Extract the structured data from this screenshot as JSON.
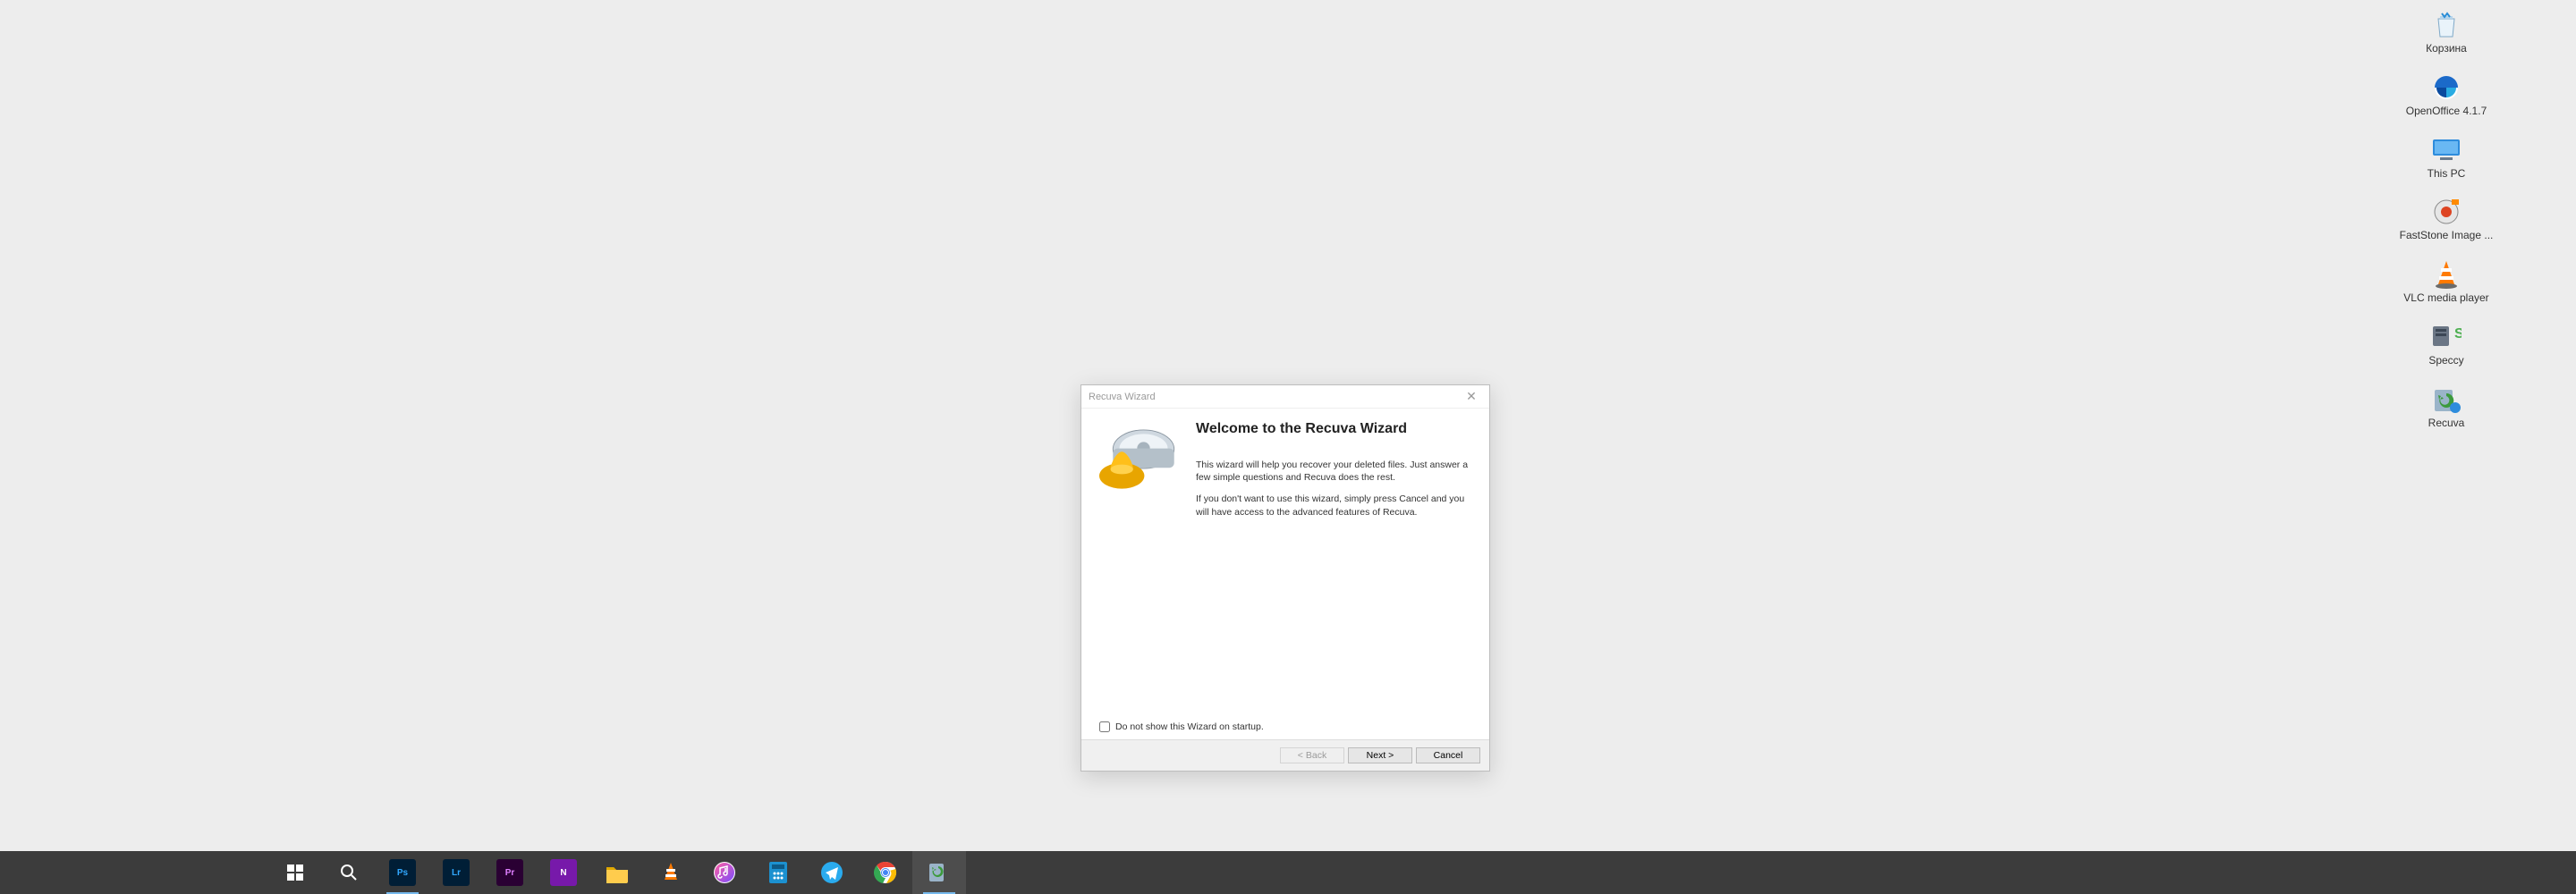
{
  "desktop": {
    "icons": [
      {
        "name": "recycle-bin",
        "label": "Корзина"
      },
      {
        "name": "openoffice",
        "label": "OpenOffice 4.1.7"
      },
      {
        "name": "this-pc",
        "label": "This PC"
      },
      {
        "name": "faststone",
        "label": "FastStone Image ..."
      },
      {
        "name": "vlc",
        "label": "VLC media player"
      },
      {
        "name": "speccy",
        "label": "Speccy"
      },
      {
        "name": "recuva",
        "label": "Recuva"
      }
    ]
  },
  "wizard": {
    "title": "Recuva Wizard",
    "heading": "Welcome to the Recuva Wizard",
    "para1": "This wizard will help you recover your deleted files.  Just answer a few simple questions and Recuva does the rest.",
    "para2": "If you don't want to use this wizard, simply press Cancel and you will have access to the advanced features of Recuva.",
    "checkbox_label": "Do not show this Wizard on startup.",
    "buttons": {
      "back": "< Back",
      "next": "Next >",
      "cancel": "Cancel"
    }
  },
  "taskbar": {
    "items": [
      {
        "name": "start",
        "glyph": "win",
        "color": "#fff",
        "active": false
      },
      {
        "name": "search",
        "glyph": "search",
        "color": "#fff",
        "active": false
      },
      {
        "name": "photoshop",
        "text": "Ps",
        "bg": "#001e36",
        "fg": "#31a8ff",
        "active": false
      },
      {
        "name": "lightroom",
        "text": "Lr",
        "bg": "#001e36",
        "fg": "#31a8ff",
        "active": false
      },
      {
        "name": "premiere",
        "text": "Pr",
        "bg": "#2a0033",
        "fg": "#e080ff",
        "active": false
      },
      {
        "name": "onenote",
        "text": "N",
        "bg": "#7719aa",
        "fg": "#fff",
        "active": false
      },
      {
        "name": "explorer",
        "glyph": "folder",
        "color": "#ffcc4d",
        "active": false
      },
      {
        "name": "vlc",
        "glyph": "cone",
        "color": "#ff7a00",
        "active": false
      },
      {
        "name": "itunes",
        "glyph": "note",
        "color": "#ff3b64",
        "active": false
      },
      {
        "name": "calculator",
        "glyph": "calc",
        "color": "#1c91d0",
        "active": false
      },
      {
        "name": "telegram",
        "glyph": "plane",
        "color": "#2AABEE",
        "active": false
      },
      {
        "name": "chrome",
        "glyph": "chrome",
        "color": "#ea4335",
        "active": false
      },
      {
        "name": "recuva",
        "glyph": "recuva",
        "color": "#7a9c5a",
        "active": true
      }
    ]
  }
}
